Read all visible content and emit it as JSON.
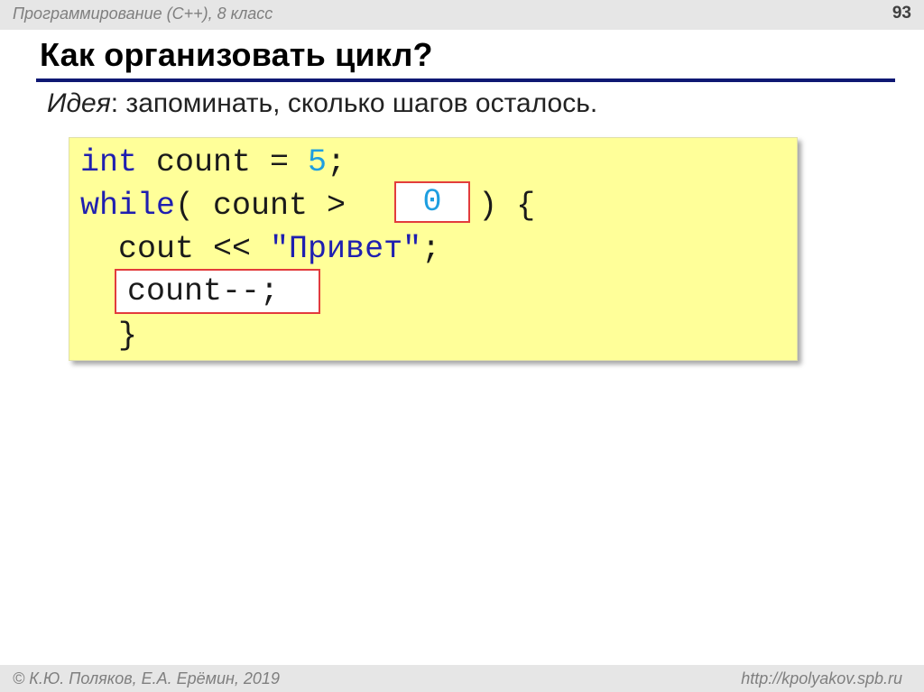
{
  "header": {
    "course": "Программирование (С++), 8 класс",
    "page_number": "93"
  },
  "slide": {
    "title": "Как организовать цикл?",
    "idea_lead": "Идея",
    "idea_text": ": запоминать, сколько шагов осталось."
  },
  "code": {
    "l1_kw": "int",
    "l1_mid": " count = ",
    "l1_num": "5",
    "l1_end": ";",
    "l2_kw": "while",
    "l2_mid": "( count > ",
    "l2_blank": "0",
    "l2_end": " ) {",
    "l3_start": "  cout << ",
    "l3_str": "\"Привет\"",
    "l3_end": ";",
    "l4_dec": "count--;",
    "l5_close": "  }"
  },
  "footer": {
    "copyright": "© К.Ю. Поляков, Е.А. Ерёмин, 2019",
    "site": "http://kpolyakov.spb.ru"
  },
  "colors": {
    "title_rule": "#0f1873",
    "code_background": "#ffff99",
    "keyword": "#1f1fb0",
    "number": "#1e9ee0",
    "highlight_border": "#e23c3c"
  }
}
